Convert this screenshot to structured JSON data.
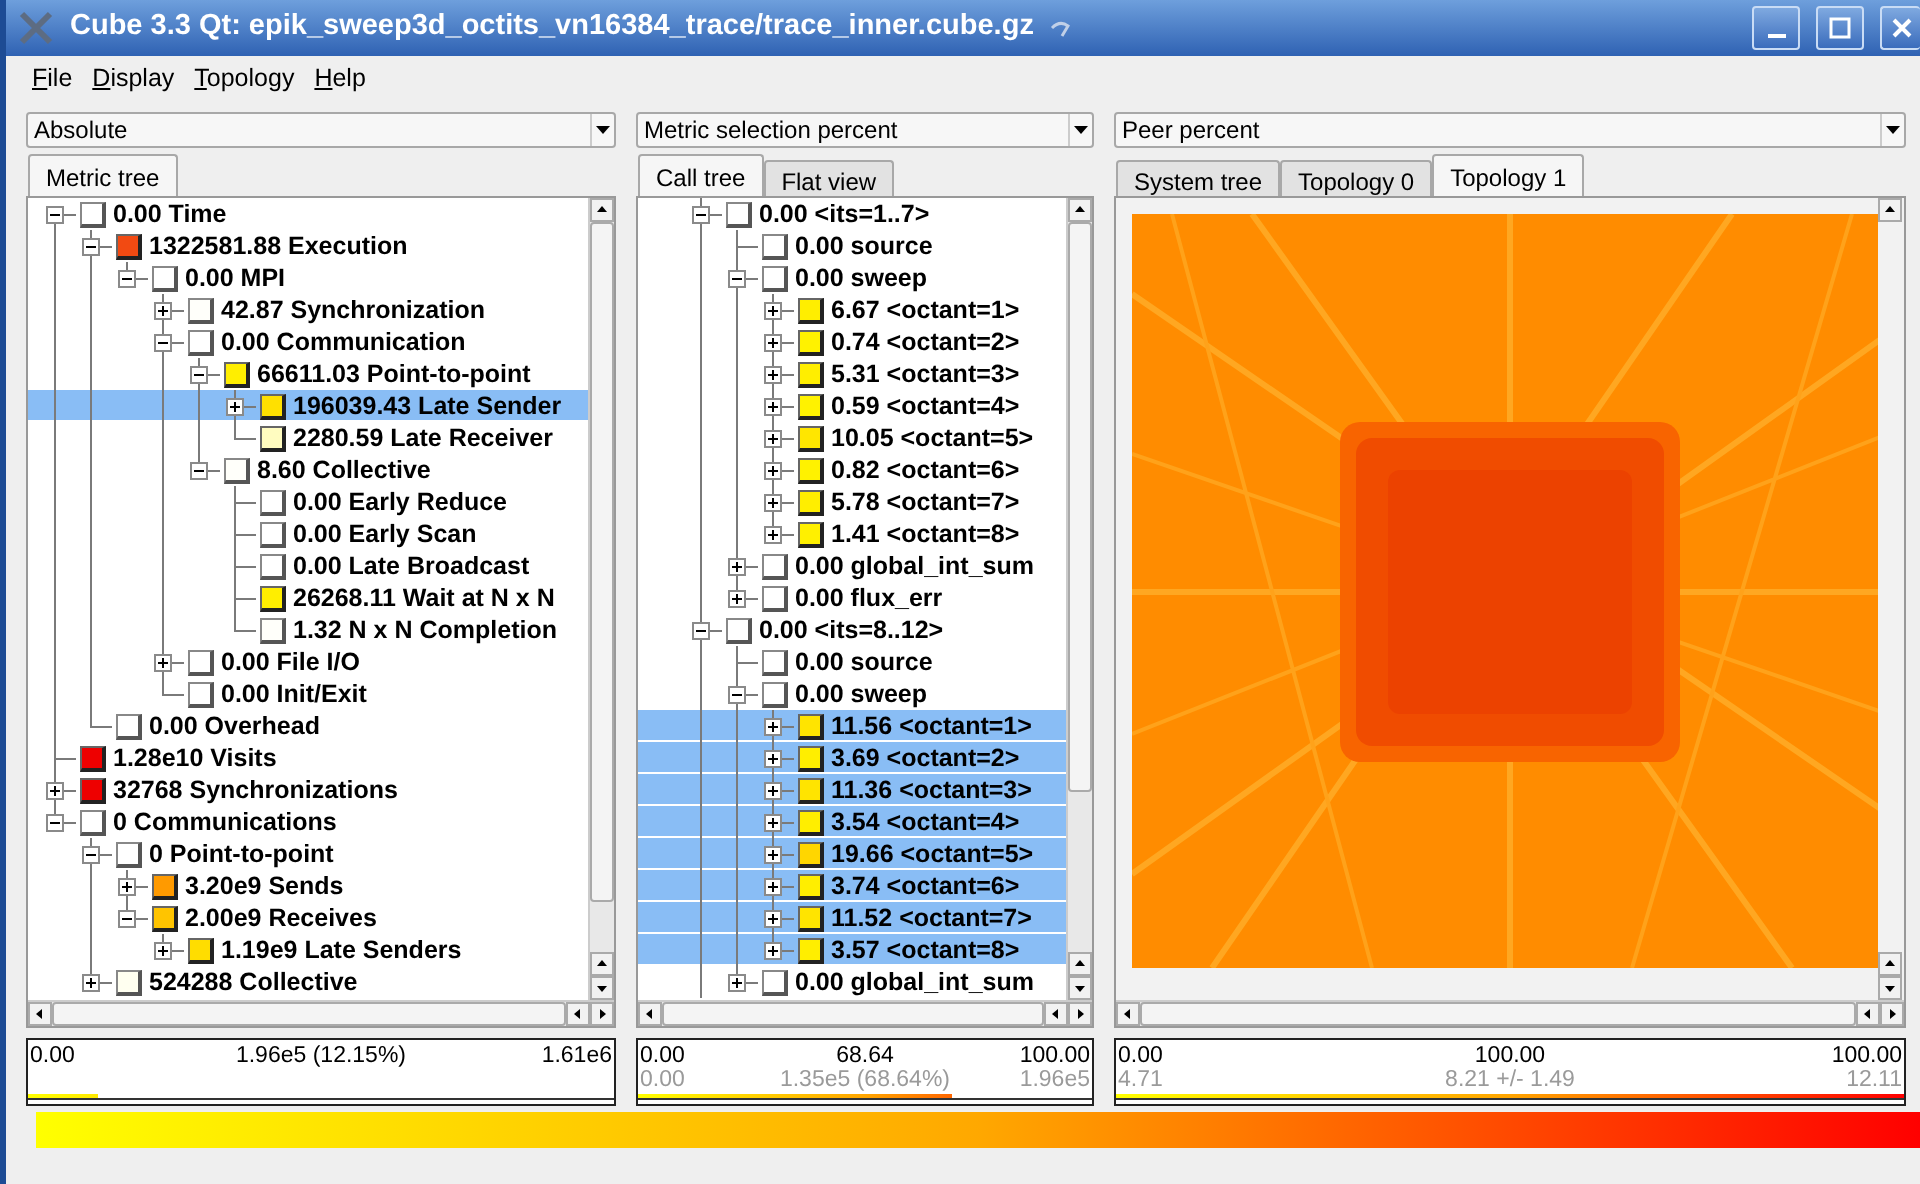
{
  "window": {
    "title": "Cube 3.3 Qt: epik_sweep3d_octits_vn16384_trace/trace_inner.cube.gz"
  },
  "menu": [
    "File",
    "Display",
    "Topology",
    "Help"
  ],
  "panes": [
    {
      "dropdown": "Absolute",
      "tabs": [
        {
          "label": "Metric tree",
          "selected": true
        }
      ],
      "tree": [
        {
          "label": "0.00 Time",
          "color": "#ffffff",
          "expanded": true,
          "selected": false,
          "children": [
            {
              "label": "1322581.88 Execution",
              "color": "#f24a12",
              "expanded": true,
              "selected": false,
              "children": [
                {
                  "label": "0.00 MPI",
                  "color": "#ffffff",
                  "expanded": true,
                  "selected": false,
                  "children": [
                    {
                      "label": "42.87 Synchronization",
                      "color": "#fffffa",
                      "expanded": false,
                      "selected": false
                    },
                    {
                      "label": "0.00 Communication",
                      "color": "#ffffff",
                      "expanded": true,
                      "selected": false,
                      "children": [
                        {
                          "label": "66611.03 Point-to-point",
                          "color": "#ffee00",
                          "expanded": true,
                          "selected": false,
                          "children": [
                            {
                              "label": "196039.43 Late Sender",
                              "color": "#ffe000",
                              "expanded": false,
                              "selected": true
                            },
                            {
                              "label": "2280.59 Late Receiver",
                              "color": "#fffcc0",
                              "selected": false
                            }
                          ]
                        },
                        {
                          "label": "8.60 Collective",
                          "color": "#fffffa",
                          "expanded": true,
                          "selected": false,
                          "children": [
                            {
                              "label": "0.00 Early Reduce",
                              "color": "#ffffff",
                              "selected": false
                            },
                            {
                              "label": "0.00 Early Scan",
                              "color": "#ffffff",
                              "selected": false
                            },
                            {
                              "label": "0.00 Late Broadcast",
                              "color": "#ffffff",
                              "selected": false
                            },
                            {
                              "label": "26268.11 Wait at N x N",
                              "color": "#ffee00",
                              "selected": false
                            },
                            {
                              "label": "1.32 N x N Completion",
                              "color": "#fffffa",
                              "selected": false
                            }
                          ]
                        }
                      ]
                    },
                    {
                      "label": "0.00 File I/O",
                      "color": "#ffffff",
                      "expanded": false,
                      "selected": false
                    },
                    {
                      "label": "0.00 Init/Exit",
                      "color": "#ffffff",
                      "selected": false
                    }
                  ]
                }
              ]
            },
            {
              "label": "0.00 Overhead",
              "color": "#ffffff",
              "selected": false
            }
          ]
        },
        {
          "label": "1.28e10 Visits",
          "color": "#ee0000",
          "selected": false
        },
        {
          "label": "32768 Synchronizations",
          "color": "#ee0000",
          "expanded": false,
          "selected": false
        },
        {
          "label": "0 Communications",
          "color": "#ffffff",
          "expanded": true,
          "selected": false,
          "children": [
            {
              "label": "0 Point-to-point",
              "color": "#ffffff",
              "expanded": true,
              "selected": false,
              "children": [
                {
                  "label": "3.20e9 Sends",
                  "color": "#ff9a00",
                  "expanded": false,
                  "selected": false
                },
                {
                  "label": "2.00e9 Receives",
                  "color": "#ffc400",
                  "expanded": true,
                  "selected": false,
                  "children": [
                    {
                      "label": "1.19e9 Late Senders",
                      "color": "#ffdd00",
                      "expanded": false,
                      "selected": false
                    }
                  ]
                }
              ]
            },
            {
              "label": "524288 Collective",
              "color": "#fffff0",
              "expanded": false,
              "selected": false
            }
          ]
        }
      ],
      "stats": {
        "min": "0.00",
        "mid": "1.96e5 (12.15%)",
        "max": "1.61e6",
        "level": 0.12
      }
    },
    {
      "dropdown": "Metric selection percent",
      "tabs": [
        {
          "label": "Call tree",
          "selected": true
        },
        {
          "label": "Flat view",
          "selected": false
        }
      ],
      "tree": [
        {
          "label": "0.00 <its=1..7>",
          "color": "#ffffff",
          "expanded": true,
          "selected": false,
          "children": [
            {
              "label": "0.00 source",
              "color": "#ffffff",
              "selected": false
            },
            {
              "label": "0.00 sweep",
              "color": "#ffffff",
              "expanded": true,
              "selected": false,
              "children": [
                {
                  "label": "6.67 <octant=1>",
                  "color": "#ffee00",
                  "expanded": false,
                  "selected": false
                },
                {
                  "label": "0.74 <octant=2>",
                  "color": "#fff200",
                  "expanded": false,
                  "selected": false
                },
                {
                  "label": "5.31 <octant=3>",
                  "color": "#ffee00",
                  "expanded": false,
                  "selected": false
                },
                {
                  "label": "0.59 <octant=4>",
                  "color": "#fff200",
                  "expanded": false,
                  "selected": false
                },
                {
                  "label": "10.05 <octant=5>",
                  "color": "#ffe600",
                  "expanded": false,
                  "selected": false
                },
                {
                  "label": "0.82 <octant=6>",
                  "color": "#fff200",
                  "expanded": false,
                  "selected": false
                },
                {
                  "label": "5.78 <octant=7>",
                  "color": "#ffee00",
                  "expanded": false,
                  "selected": false
                },
                {
                  "label": "1.41 <octant=8>",
                  "color": "#fff000",
                  "expanded": false,
                  "selected": false
                }
              ]
            },
            {
              "label": "0.00 global_int_sum",
              "color": "#ffffff",
              "expanded": false,
              "selected": false
            },
            {
              "label": "0.00 flux_err",
              "color": "#ffffff",
              "expanded": false,
              "selected": false
            }
          ]
        },
        {
          "label": "0.00 <its=8..12>",
          "color": "#ffffff",
          "expanded": true,
          "selected": false,
          "children": [
            {
              "label": "0.00 source",
              "color": "#ffffff",
              "selected": false
            },
            {
              "label": "0.00 sweep",
              "color": "#ffffff",
              "expanded": true,
              "selected": false,
              "children": [
                {
                  "label": "11.56 <octant=1>",
                  "color": "#ffe400",
                  "expanded": false,
                  "selected": true
                },
                {
                  "label": "3.69 <octant=2>",
                  "color": "#ffee00",
                  "expanded": false,
                  "selected": true
                },
                {
                  "label": "11.36 <octant=3>",
                  "color": "#ffe400",
                  "expanded": false,
                  "selected": true
                },
                {
                  "label": "3.54 <octant=4>",
                  "color": "#ffee00",
                  "expanded": false,
                  "selected": true
                },
                {
                  "label": "19.66 <octant=5>",
                  "color": "#ffd600",
                  "expanded": false,
                  "selected": true
                },
                {
                  "label": "3.74 <octant=6>",
                  "color": "#ffee00",
                  "expanded": false,
                  "selected": true
                },
                {
                  "label": "11.52 <octant=7>",
                  "color": "#ffe400",
                  "expanded": false,
                  "selected": true
                },
                {
                  "label": "3.57 <octant=8>",
                  "color": "#ffee00",
                  "expanded": false,
                  "selected": true
                }
              ]
            },
            {
              "label": "0.00 global_int_sum",
              "color": "#ffffff",
              "expanded": false,
              "selected": false
            }
          ]
        }
      ],
      "stats": {
        "min": "0.00",
        "mid": "68.64",
        "max": "100.00",
        "sub_min": "0.00",
        "sub_mid": "1.35e5 (68.64%)",
        "sub_max": "1.96e5",
        "level": 0.69
      }
    },
    {
      "dropdown": "Peer percent",
      "tabs": [
        {
          "label": "System tree",
          "selected": false
        },
        {
          "label": "Topology 0",
          "selected": false
        },
        {
          "label": "Topology 1",
          "selected": true
        }
      ],
      "stats": {
        "min": "0.00",
        "mid": "100.00",
        "max": "100.00",
        "sub_min": "4.71",
        "sub_mid": "8.21 +/- 1.49",
        "sub_max": "12.11",
        "level": 1
      }
    }
  ]
}
